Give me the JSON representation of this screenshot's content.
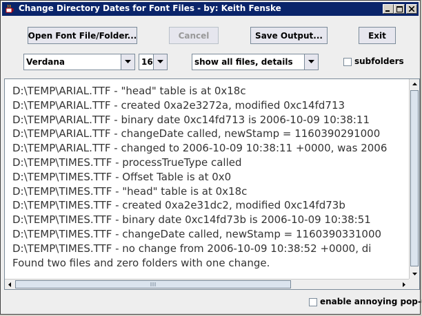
{
  "window": {
    "title": "Change Directory Dates for Font Files - by: Keith Fenske",
    "controls": {
      "minimize": "_",
      "maximize": "□",
      "close": "X"
    }
  },
  "toolbar": {
    "open_label": "Open Font File/Folder...",
    "cancel_label": "Cancel",
    "save_label": "Save Output...",
    "exit_label": "Exit"
  },
  "options": {
    "font_name": "Verdana",
    "font_size": "16",
    "display_mode": "show all files, details",
    "subfolders_label": "subfolders",
    "subfolders_checked": false
  },
  "output": {
    "lines": [
      "D:\\TEMP\\ARIAL.TTF - \"head\" table is at 0x18c",
      "D:\\TEMP\\ARIAL.TTF - created 0xa2e3272a, modified 0xc14fd713",
      "D:\\TEMP\\ARIAL.TTF - binary date 0xc14fd713 is 2006-10-09 10:38:11",
      "D:\\TEMP\\ARIAL.TTF - changeDate called, newStamp = 1160390291000",
      "D:\\TEMP\\ARIAL.TTF - changed to 2006-10-09 10:38:11 +0000, was 2006",
      "D:\\TEMP\\TIMES.TTF - processTrueType called",
      "D:\\TEMP\\TIMES.TTF - Offset Table is at 0x0",
      "D:\\TEMP\\TIMES.TTF - \"head\" table is at 0x18c",
      "D:\\TEMP\\TIMES.TTF - created 0xa2e31dc2, modified 0xc14fd73b",
      "D:\\TEMP\\TIMES.TTF - binary date 0xc14fd73b is 2006-10-09 10:38:51",
      "D:\\TEMP\\TIMES.TTF - changeDate called, newStamp = 1160390331000",
      "D:\\TEMP\\TIMES.TTF - no change from 2006-10-09 10:38:52 +0000, di",
      "Found two files and zero folders with one change."
    ]
  },
  "footer": {
    "popup_label": "enable annoying pop-up",
    "popup_checked": false
  }
}
